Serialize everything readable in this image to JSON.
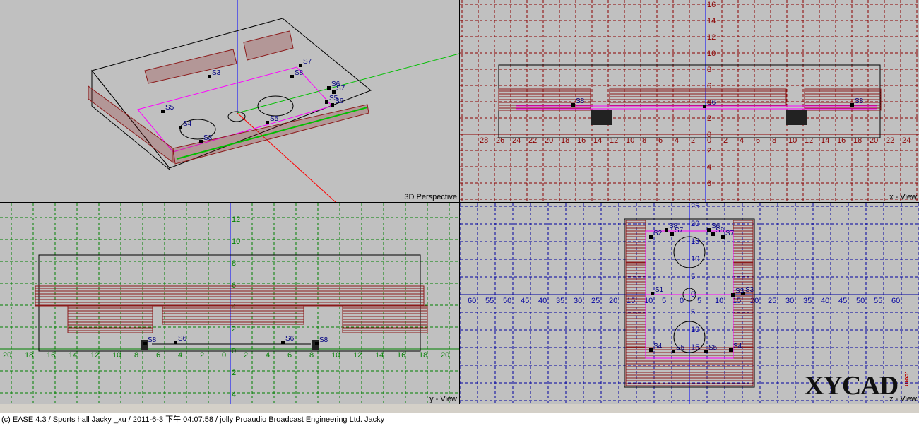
{
  "panes": {
    "perspective": {
      "label": "3D Perspective"
    },
    "xview": {
      "label": "x - View",
      "x_ticks": [
        "28",
        "26",
        "24",
        "22",
        "20",
        "18",
        "16",
        "14",
        "12",
        "10",
        "8",
        "6",
        "4",
        "2",
        "0",
        "2",
        "4",
        "6",
        "8",
        "10",
        "12",
        "14",
        "16",
        "18",
        "20",
        "22",
        "24"
      ],
      "y_ticks": [
        "16",
        "14",
        "12",
        "10",
        "8",
        "6",
        "4",
        "2",
        "0",
        "2",
        "4",
        "6"
      ]
    },
    "yview": {
      "label": "y - View",
      "x_ticks": [
        "20",
        "18",
        "16",
        "14",
        "12",
        "10",
        "8",
        "6",
        "4",
        "2",
        "0",
        "2",
        "4",
        "6",
        "8",
        "10",
        "12",
        "14",
        "16",
        "18",
        "20"
      ],
      "y_ticks": [
        "12",
        "10",
        "8",
        "6",
        "4",
        "2",
        "0",
        "2",
        "4"
      ]
    },
    "zview": {
      "label": "z - View",
      "x_ticks": [
        "60",
        "55",
        "50",
        "45",
        "40",
        "35",
        "30",
        "25",
        "20",
        "15",
        "10",
        "5",
        "0",
        "5",
        "10",
        "15",
        "20",
        "25",
        "30",
        "35",
        "40",
        "45",
        "50",
        "55",
        "60"
      ],
      "y_ticks": [
        "25",
        "20",
        "15",
        "10",
        "5",
        "0",
        "5",
        "10",
        "15"
      ]
    }
  },
  "speakers": {
    "perspective": [
      "S3",
      "S7",
      "S8",
      "S6",
      "S5",
      "S5",
      "S4",
      "S3",
      "S5",
      "S6",
      "S7"
    ],
    "xview": [
      "S8",
      "S6",
      "S8"
    ],
    "yview": [
      "S6",
      "S6",
      "S8",
      "S8"
    ],
    "zview": [
      "S2",
      "S8",
      "S7",
      "S6",
      "S8",
      "S7",
      "S3",
      "S1",
      "S3",
      "S4",
      "S5",
      "S5",
      "S4"
    ]
  },
  "status": {
    "text": "(c) EASE 4.3  / Sports hall Jacky _xu / 2011-6-3 下午 04:07:58 / jolly Proaudio Broadcast Engineering Ltd. Jacky"
  },
  "logo": {
    "text": "XYCAD",
    "suffix": ".com"
  },
  "colors": {
    "background": "#c0c0c0",
    "grid_red": "#8b0000",
    "grid_green": "#008000",
    "grid_blue": "#0000a0",
    "seating": "#8b1a1a",
    "magenta": "#ff00ff",
    "speaker": "#000080"
  }
}
